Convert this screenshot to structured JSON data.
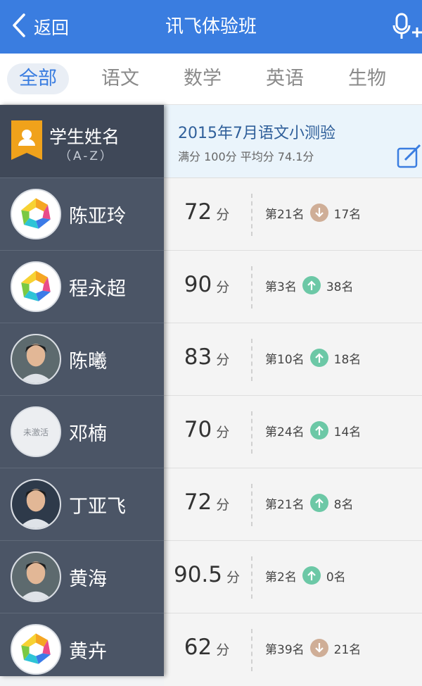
{
  "header": {
    "back_label": "返回",
    "title": "讯飞体验班"
  },
  "tabs": [
    "全部",
    "语文",
    "数学",
    "英语",
    "生物"
  ],
  "sidebar": {
    "title": "学生姓名",
    "sort_hint": "（A-Z）"
  },
  "exam": {
    "title": "2015年7月语文小测验",
    "meta": "满分 100分  平均分 74.1分"
  },
  "score_unit": "分",
  "students": [
    {
      "name": "陈亚玲",
      "score": "72",
      "rank": "第21名",
      "trend": "down",
      "change": "17名",
      "avatar": "app-logo"
    },
    {
      "name": "程永超",
      "score": "90",
      "rank": "第3名",
      "trend": "up",
      "change": "38名",
      "avatar": "app-logo"
    },
    {
      "name": "陈曦",
      "score": "83",
      "rank": "第10名",
      "trend": "up",
      "change": "18名",
      "avatar": "photo"
    },
    {
      "name": "邓楠",
      "score": "70",
      "rank": "第24名",
      "trend": "up",
      "change": "14名",
      "avatar": "inactive",
      "avatar_text": "未激活"
    },
    {
      "name": "丁亚飞",
      "score": "72",
      "rank": "第21名",
      "trend": "up",
      "change": "8名",
      "avatar": "photo"
    },
    {
      "name": "黄海",
      "score": "90.5",
      "rank": "第2名",
      "trend": "up",
      "change": "0名",
      "avatar": "photo"
    },
    {
      "name": "黄卉",
      "score": "62",
      "rank": "第39名",
      "trend": "down",
      "change": "21名",
      "avatar": "app-logo"
    }
  ],
  "colors": {
    "brand_blue": "#3a7de0",
    "up_green": "#6cc8a6",
    "down_tan": "#cfae97",
    "sidebar": "#4b5566"
  }
}
